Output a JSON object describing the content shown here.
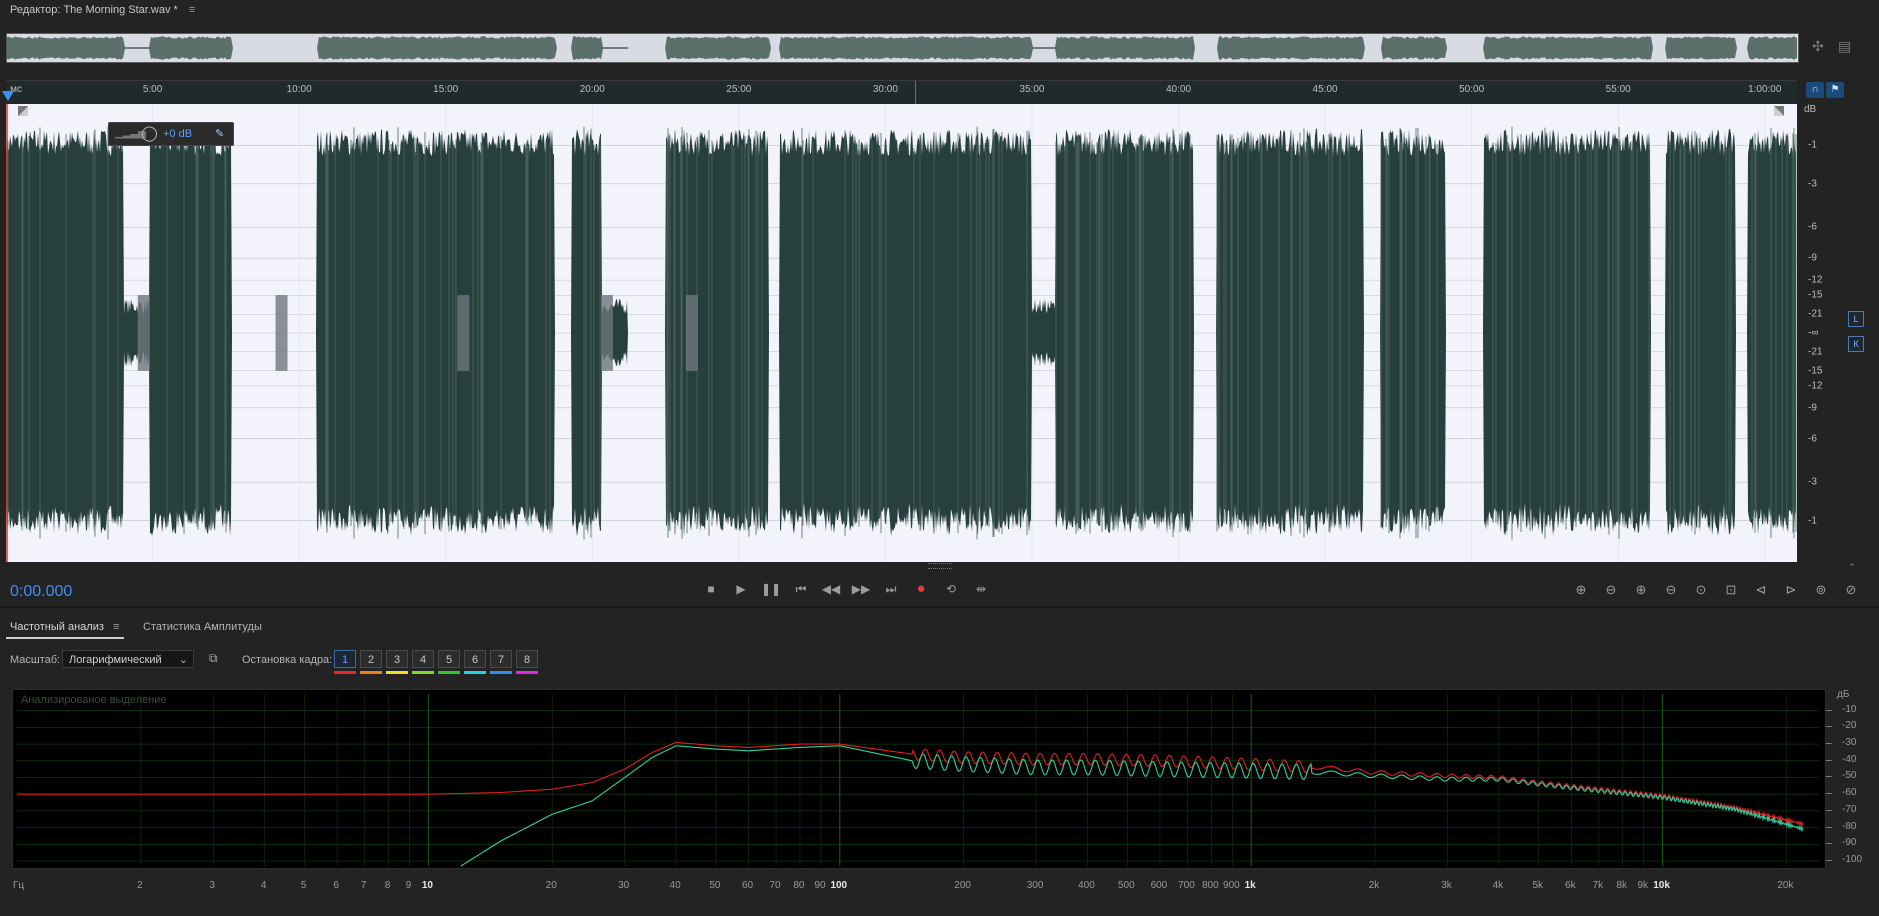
{
  "window": {
    "title": "Редактор: The Morning Star.wav *",
    "menu_icon": "hamburger-icon"
  },
  "time_ruler": {
    "labels": [
      "мс",
      "5:00",
      "10:00",
      "15:00",
      "20:00",
      "25:00",
      "30:00",
      "35:00",
      "40:00",
      "45:00",
      "50:00",
      "55:00",
      "1:00:00"
    ],
    "minutes": [
      0,
      5,
      10,
      15,
      20,
      25,
      30,
      35,
      40,
      45,
      50,
      55,
      60
    ],
    "duration_min": 61.1,
    "playhead_min": 0,
    "view_marker_min": 31
  },
  "hud": {
    "gain": "+0 dB"
  },
  "db_scale": {
    "unit": "dB",
    "labels": [
      "-1",
      "-3",
      "-6",
      "-9",
      "-12",
      "-15",
      "-21",
      "-∞",
      "-21",
      "-15",
      "-12",
      "-9",
      "-6",
      "-3",
      "-1"
    ],
    "amplitudes": [
      0.891,
      0.708,
      0.501,
      0.355,
      0.251,
      0.178,
      0.089,
      0,
      -0.089,
      -0.178,
      -0.251,
      -0.355,
      -0.501,
      -0.708,
      -0.891
    ],
    "channels": [
      "L",
      "К"
    ]
  },
  "waveform": {
    "silence_gaps_min": [
      [
        7.7,
        10.6
      ],
      [
        18.7,
        19.3
      ],
      [
        21.2,
        22.5
      ],
      [
        26.0,
        26.4
      ],
      [
        40.5,
        41.3
      ],
      [
        46.3,
        46.9
      ],
      [
        49.1,
        50.4
      ],
      [
        56.1,
        56.6
      ],
      [
        59.0,
        59.4
      ]
    ],
    "quiet_regions_min": [
      [
        4.0,
        4.9
      ],
      [
        9.2,
        10.0
      ],
      [
        20.3,
        21.5
      ],
      [
        35.0,
        35.8
      ]
    ],
    "gap_pop_min": [
      4.7,
      9.4,
      15.6,
      20.5,
      23.4
    ],
    "colors": {
      "wave": "#27403b",
      "wave_hi": "#4d6660",
      "bg": "#f3f4fb",
      "grid": "#b9c3bf"
    }
  },
  "transport": {
    "time": "0:00.000",
    "buttons": [
      {
        "name": "stop-icon",
        "glyph": "■"
      },
      {
        "name": "play-icon",
        "glyph": "▶"
      },
      {
        "name": "pause-icon",
        "glyph": "❚❚"
      },
      {
        "name": "skip-to-start-icon",
        "glyph": "⏮"
      },
      {
        "name": "rewind-icon",
        "glyph": "◀◀"
      },
      {
        "name": "fast-forward-icon",
        "glyph": "▶▶"
      },
      {
        "name": "skip-to-end-icon",
        "glyph": "⏭"
      },
      {
        "name": "record-icon",
        "glyph": "●"
      },
      {
        "name": "loop-icon",
        "glyph": "⟲"
      },
      {
        "name": "skip-selection-icon",
        "glyph": "⇹"
      }
    ],
    "zoom_buttons": [
      "zoom-in-amplitude-icon",
      "zoom-out-amplitude-icon",
      "zoom-in-time-icon",
      "zoom-out-time-icon",
      "zoom-reset-icon",
      "zoom-selection-icon",
      "zoom-in-left-icon",
      "zoom-in-right-icon",
      "zoom-full-icon",
      "zoom-out-full-icon"
    ]
  },
  "analysis": {
    "tabs": [
      {
        "label": "Частотный анализ"
      },
      {
        "label": "Статистика Амплитуды"
      }
    ],
    "scale_label": "Масштаб:",
    "scale_value": "Логарифмический",
    "hold_label": "Остановка кадра:",
    "hold_buttons": [
      "1",
      "2",
      "3",
      "4",
      "5",
      "6",
      "7",
      "8"
    ],
    "hold_colors": [
      "#e32b2b",
      "#f07f17",
      "#e8e020",
      "#80d82a",
      "#35c235",
      "#20d4e0",
      "#2d8ff0",
      "#e02ae0"
    ],
    "hold_selected": "1",
    "placeholder": "Анализированое выделение"
  },
  "chart_data": {
    "type": "line",
    "xlabel": "Гц",
    "ylabel": "дБ",
    "x_scale": "log",
    "x_ticks": [
      2,
      3,
      4,
      5,
      6,
      7,
      8,
      9,
      10,
      20,
      30,
      40,
      50,
      60,
      70,
      80,
      90,
      100,
      200,
      300,
      400,
      500,
      600,
      700,
      800,
      900,
      1000,
      2000,
      3000,
      4000,
      5000,
      6000,
      7000,
      8000,
      9000,
      10000,
      20000
    ],
    "x_tick_labels": [
      "2",
      "3",
      "4",
      "5",
      "6",
      "7",
      "8",
      "9",
      "10",
      "20",
      "30",
      "40",
      "50",
      "60",
      "70",
      "80",
      "90",
      "100",
      "200",
      "300",
      "400",
      "500",
      "600",
      "700",
      "800",
      "900",
      "1k",
      "2k",
      "3k",
      "4k",
      "5k",
      "6k",
      "7k",
      "8k",
      "9k",
      "10k",
      "20k"
    ],
    "xlim": [
      1,
      24000
    ],
    "y_ticks": [
      -10,
      -20,
      -30,
      -40,
      -50,
      -60,
      -70,
      -80,
      -90,
      -100
    ],
    "y_tick_labels": [
      "-10",
      "-20",
      "-30",
      "-40",
      "-50",
      "-60",
      "-70",
      "-80",
      "-90",
      "-100"
    ],
    "ylim": [
      -103,
      0
    ],
    "series": [
      {
        "color": "#e02020",
        "x": [
          1,
          10,
          15,
          20,
          25,
          30,
          35,
          40,
          50,
          60,
          80,
          100,
          150,
          200,
          300,
          400,
          600,
          1000,
          1500,
          2000,
          3000,
          4000,
          5000,
          7000,
          10000,
          15000,
          22000
        ],
        "y": [
          -60,
          -60,
          -59,
          -57,
          -53,
          -45,
          -35,
          -29,
          -31,
          -32,
          -30,
          -30,
          -36,
          -38,
          -39,
          -39,
          -40,
          -42,
          -44,
          -47,
          -49,
          -50,
          -53,
          -57,
          -61,
          -68,
          -78
        ],
        "ripple": {
          "from": 150,
          "to": 1400,
          "amp": 3.5
        }
      },
      {
        "color": "#30d0a0",
        "x": [
          12,
          15,
          20,
          25,
          30,
          35,
          40,
          50,
          60,
          80,
          100,
          150,
          200,
          300,
          400,
          600,
          1000,
          1500,
          2000,
          3000,
          4000,
          5000,
          7000,
          10000,
          15000,
          22000
        ],
        "y": [
          -103,
          -88,
          -72,
          -64,
          -50,
          -38,
          -31,
          -33,
          -34,
          -32,
          -31,
          -40,
          -42,
          -44,
          -44,
          -45,
          -46,
          -47,
          -49,
          -51,
          -51,
          -54,
          -58,
          -62,
          -69,
          -81
        ],
        "ripple": {
          "from": 150,
          "to": 1400,
          "amp": 4.5
        }
      }
    ]
  }
}
